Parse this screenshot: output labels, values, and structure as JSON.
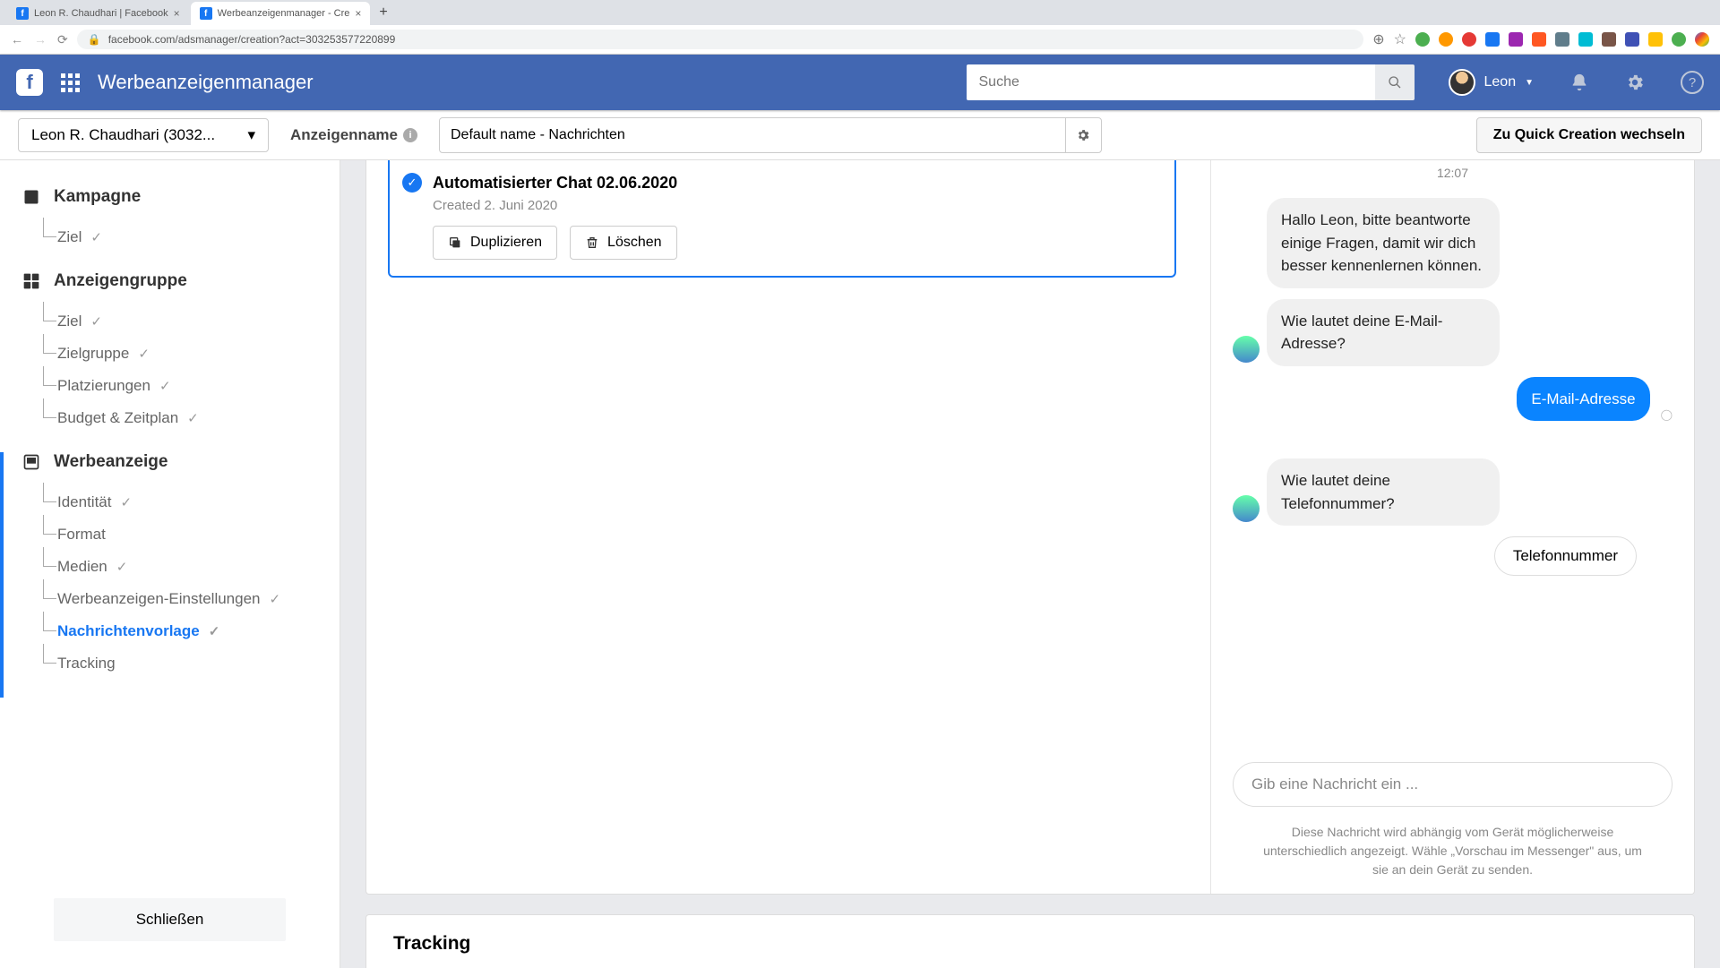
{
  "browser": {
    "tabs": [
      {
        "title": "Leon R. Chaudhari | Facebook"
      },
      {
        "title": "Werbeanzeigenmanager - Cre"
      }
    ],
    "url": "facebook.com/adsmanager/creation?act=303253577220899"
  },
  "header": {
    "appTitle": "Werbeanzeigenmanager",
    "searchPlaceholder": "Suche",
    "userName": "Leon"
  },
  "topbar": {
    "accountLabel": "Leon R. Chaudhari (3032...",
    "adNameLabel": "Anzeigenname",
    "adNameValue": "Default name - Nachrichten",
    "quickBtn": "Zu Quick Creation wechseln"
  },
  "sidebar": {
    "campaign": {
      "label": "Kampagne",
      "items": [
        {
          "label": "Ziel"
        }
      ]
    },
    "adset": {
      "label": "Anzeigengruppe",
      "items": [
        {
          "label": "Ziel"
        },
        {
          "label": "Zielgruppe"
        },
        {
          "label": "Platzierungen"
        },
        {
          "label": "Budget & Zeitplan"
        }
      ]
    },
    "ad": {
      "label": "Werbeanzeige",
      "items": [
        {
          "label": "Identität"
        },
        {
          "label": "Format"
        },
        {
          "label": "Medien"
        },
        {
          "label": "Werbeanzeigen-Einstellungen"
        },
        {
          "label": "Nachrichtenvorlage"
        },
        {
          "label": "Tracking"
        }
      ]
    },
    "closeBtn": "Schließen"
  },
  "template": {
    "title": "Automatisierter Chat 02.06.2020",
    "created": "Created 2. Juni 2020",
    "duplicate": "Duplizieren",
    "delete": "Löschen"
  },
  "chat": {
    "time": "12:07",
    "msg1": "Hallo Leon, bitte beantworte einige Fragen, damit wir dich besser kennenlernen können.",
    "msg2": "Wie lautet deine E-Mail-Adresse?",
    "reply1": "E-Mail-Adresse",
    "msg3": "Wie lautet deine Telefonnummer?",
    "option": "Telefonnummer",
    "inputPlaceholder": "Gib eine Nachricht ein ...",
    "disclaimer": "Diese Nachricht wird abhängig vom Gerät möglicherweise unterschiedlich angezeigt. Wähle „Vorschau im Messenger\" aus, um sie an dein Gerät zu senden."
  },
  "tracking": {
    "title": "Tracking"
  }
}
